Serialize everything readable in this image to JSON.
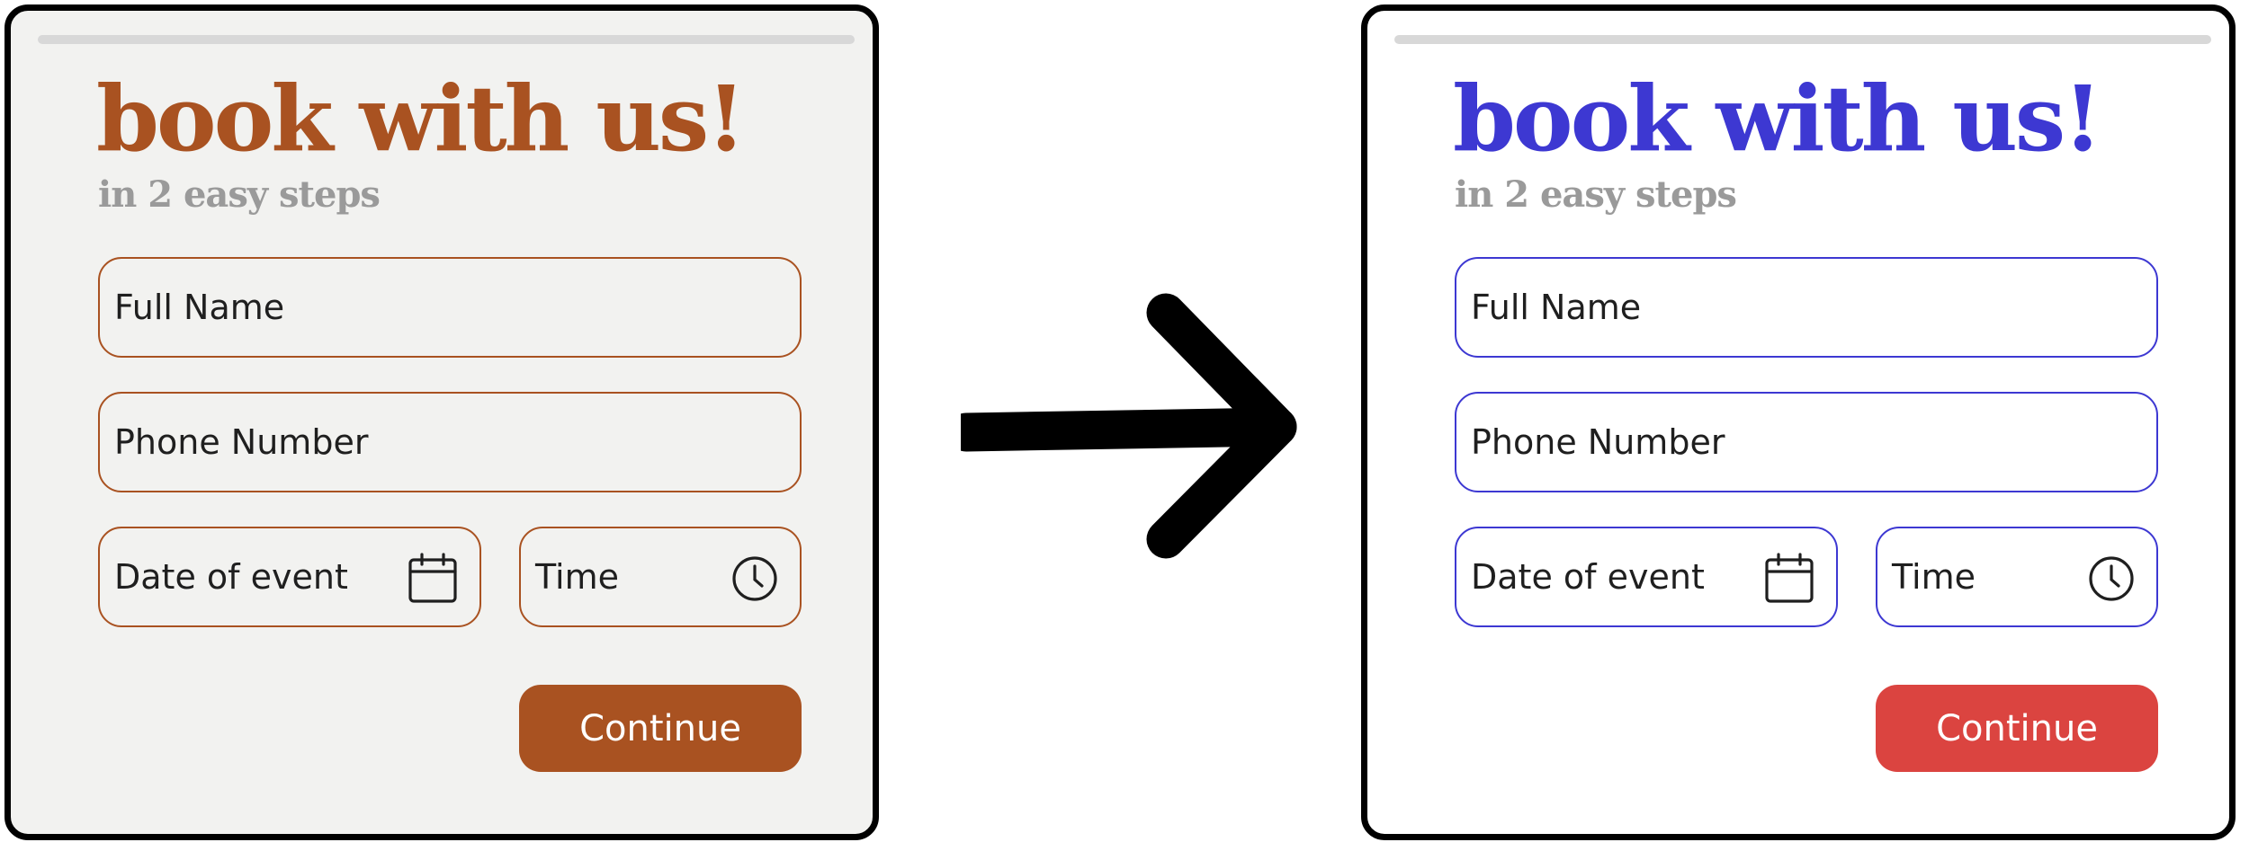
{
  "panels": [
    {
      "title": "book with us!",
      "subtitle": "in 2 easy steps",
      "fields": {
        "full_name": "Full Name",
        "phone": "Phone Number",
        "date": "Date of event",
        "time": "Time"
      },
      "icons": {
        "date": "calendar-icon",
        "time": "clock-icon"
      },
      "button_label": "Continue",
      "colors": {
        "background": "#f2f2f0",
        "accent": "#a95221",
        "field_border": "#a95221",
        "button": "#a95221",
        "subtitle": "#9a9a9a"
      }
    },
    {
      "title": "book with us!",
      "subtitle": "in 2 easy steps",
      "fields": {
        "full_name": "Full Name",
        "phone": "Phone Number",
        "date": "Date of event",
        "time": "Time"
      },
      "icons": {
        "date": "calendar-icon",
        "time": "clock-icon"
      },
      "button_label": "Continue",
      "colors": {
        "background": "#ffffff",
        "accent": "#3d38d2",
        "field_border": "#3d38d2",
        "button": "#db4440",
        "subtitle": "#9a9a9a"
      }
    }
  ],
  "connector": {
    "icon": "arrow-right-icon",
    "color": "#000000"
  }
}
